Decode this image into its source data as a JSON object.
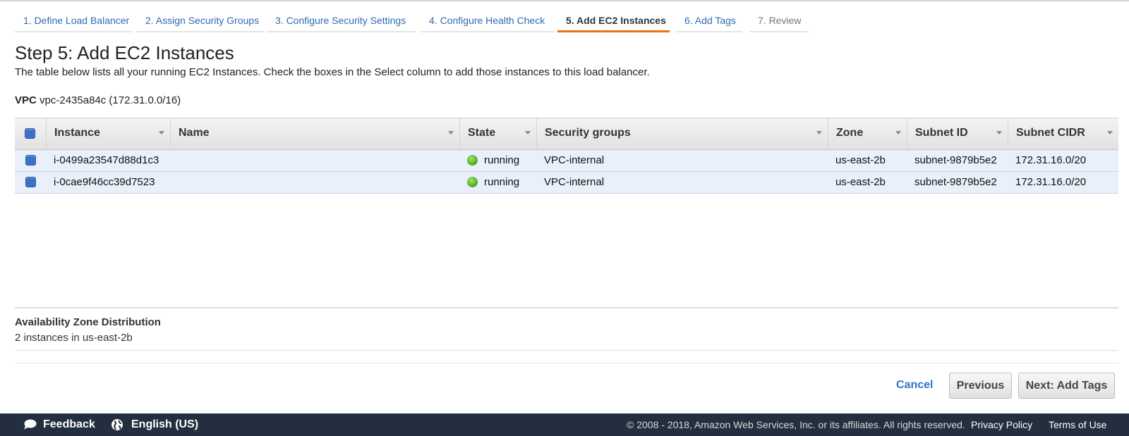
{
  "wizard": {
    "tabs": [
      {
        "label": "1. Define Load Balancer"
      },
      {
        "label": "2. Assign Security Groups"
      },
      {
        "label": "3. Configure Security Settings"
      },
      {
        "label": "4. Configure Health Check"
      },
      {
        "label": "5. Add EC2 Instances"
      },
      {
        "label": "6. Add Tags"
      },
      {
        "label": "7. Review"
      }
    ],
    "active_index": 4
  },
  "page": {
    "title": "Step 5: Add EC2 Instances",
    "description": "The table below lists all your running EC2 Instances. Check the boxes in the Select column to add those instances to this load balancer.",
    "vpc_label": "VPC",
    "vpc_value": "vpc-2435a84c (172.31.0.0/16)"
  },
  "table": {
    "headers": {
      "instance": "Instance",
      "name": "Name",
      "state": "State",
      "security_groups": "Security groups",
      "zone": "Zone",
      "subnet_id": "Subnet ID",
      "subnet_cidr": "Subnet CIDR"
    },
    "select_all_checked": true,
    "rows": [
      {
        "checked": true,
        "instance": "i-0499a23547d88d1c3",
        "name": "",
        "state": "running",
        "security_groups": "VPC-internal",
        "zone": "us-east-2b",
        "subnet_id": "subnet-9879b5e2",
        "subnet_cidr": "172.31.16.0/20"
      },
      {
        "checked": true,
        "instance": "i-0cae9f46cc39d7523",
        "name": "",
        "state": "running",
        "security_groups": "VPC-internal",
        "zone": "us-east-2b",
        "subnet_id": "subnet-9879b5e2",
        "subnet_cidr": "172.31.16.0/20"
      }
    ]
  },
  "az": {
    "title": "Availability Zone Distribution",
    "text": "2 instances in us-east-2b"
  },
  "actions": {
    "cancel": "Cancel",
    "previous": "Previous",
    "next": "Next: Add Tags"
  },
  "footer": {
    "feedback": "Feedback",
    "language": "English (US)",
    "copyright": "© 2008 - 2018, Amazon Web Services, Inc. or its affiliates. All rights reserved.",
    "privacy": "Privacy Policy",
    "terms": "Terms of Use"
  },
  "colors": {
    "accent_orange": "#ec7211",
    "link_blue": "#2f6bb0",
    "row_selected": "#e9f0fa",
    "footer_bg": "#232f3e",
    "state_running": "#46a81c"
  }
}
